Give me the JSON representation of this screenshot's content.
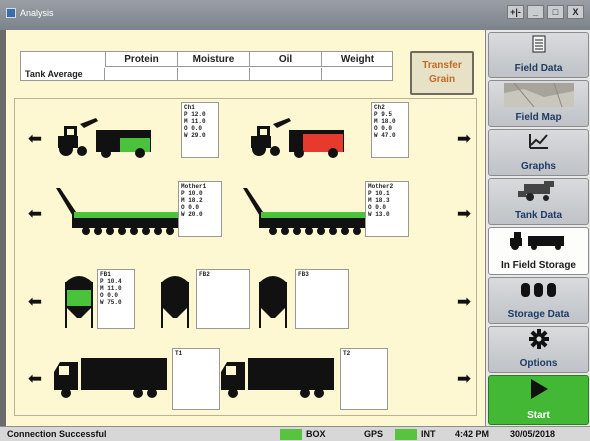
{
  "window": {
    "title": "Analysis",
    "controls": [
      "+|-",
      "_",
      "□",
      "X"
    ]
  },
  "table": {
    "columns": [
      "Protein",
      "Moisture",
      "Oil",
      "Weight"
    ],
    "row_label": "Tank Average"
  },
  "transfer_button": {
    "line1": "Transfer",
    "line2": "Grain"
  },
  "arrows": {
    "left": "⬅",
    "right": "➡"
  },
  "rows": [
    {
      "items": [
        {
          "name": "Ch1",
          "P": "12.0",
          "M": "11.0",
          "O": "0.0",
          "W": "29.0",
          "fill_color": "#4ac23c"
        },
        {
          "name": "Ch2",
          "P": "9.5",
          "M": "18.0",
          "O": "0.0",
          "W": "47.0",
          "fill_color": "#e63a2e"
        }
      ]
    },
    {
      "items": [
        {
          "name": "Mother1",
          "P": "10.0",
          "M": "18.2",
          "O": "0.0",
          "W": "20.0",
          "fill_color": "#4ac23c"
        },
        {
          "name": "Mother2",
          "P": "10.1",
          "M": "18.3",
          "O": "0.0",
          "W": "13.0",
          "fill_color": "#4ac23c"
        }
      ]
    },
    {
      "items": [
        {
          "name": "FB1",
          "P": "10.4",
          "M": "11.0",
          "O": "0.0",
          "W": "75.0",
          "fill_color": "#4ac23c"
        },
        {
          "name": "FB2",
          "P": "",
          "M": "",
          "O": "",
          "W": ""
        },
        {
          "name": "FB3",
          "P": "",
          "M": "",
          "O": "",
          "W": ""
        }
      ]
    },
    {
      "items": [
        {
          "name": "T1"
        },
        {
          "name": "T2"
        }
      ]
    }
  ],
  "sidebar": {
    "items": [
      {
        "label": "Field Data",
        "icon": "file-icon"
      },
      {
        "label": "Field Map",
        "icon": "map-icon"
      },
      {
        "label": "Graphs",
        "icon": "line-chart-icon"
      },
      {
        "label": "Tank Data",
        "icon": "combine-icon"
      },
      {
        "label": "In Field Storage",
        "icon": "cart-icon"
      },
      {
        "label": "Storage Data",
        "icon": "silos-icon"
      },
      {
        "label": "Options",
        "icon": "gear-icon"
      },
      {
        "label": "Start",
        "icon": "play-icon"
      }
    ]
  },
  "status": {
    "message": "Connection Successful",
    "box_label": "BOX",
    "gps_label": "GPS",
    "int_label": "INT",
    "time": "4:42 PM",
    "date": "30/05/2018"
  },
  "colors": {
    "accent_green": "#4ac23c",
    "accent_red": "#e63a2e",
    "panel_bg": "#fdf7d2"
  }
}
